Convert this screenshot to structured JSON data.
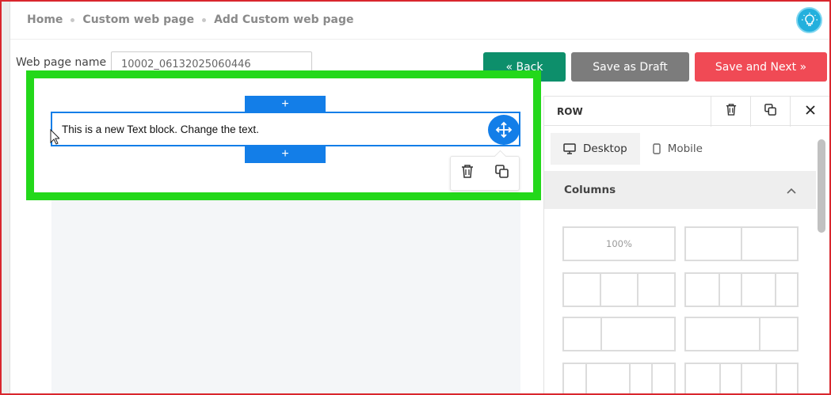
{
  "breadcrumb": {
    "home": "Home",
    "section": "Custom web page",
    "current": "Add Custom web page"
  },
  "form": {
    "name_label": "Web page name :",
    "name_value": "10002_06132025060446"
  },
  "actions": {
    "back": "« Back",
    "draft": "Save as Draft",
    "next": "Save and Next »"
  },
  "editor": {
    "text_block": "This is a new Text block. Change the text.",
    "add_symbol": "+"
  },
  "panel": {
    "title": "ROW",
    "tabs": [
      {
        "label": "Desktop",
        "icon": "monitor-icon"
      },
      {
        "label": "Mobile",
        "icon": "phone-icon"
      }
    ],
    "section_title": "Columns",
    "layouts": [
      {
        "cols": [
          {
            "label": "100%"
          }
        ]
      },
      {
        "cols": [
          {
            "label": ""
          },
          {
            "label": ""
          }
        ]
      },
      {
        "cols": [
          {
            "label": ""
          },
          {
            "label": ""
          },
          {
            "label": ""
          }
        ]
      },
      {
        "cols": [
          {
            "label": ""
          },
          {
            "label": ""
          },
          {
            "label": ""
          },
          {
            "label": ""
          }
        ]
      },
      {
        "cols": [
          {
            "label": ""
          },
          {
            "label": ""
          }
        ]
      },
      {
        "cols": [
          {
            "label": ""
          },
          {
            "label": ""
          }
        ]
      },
      {
        "cols": [
          {
            "label": ""
          },
          {
            "label": ""
          },
          {
            "label": ""
          },
          {
            "label": ""
          }
        ]
      },
      {
        "cols": [
          {
            "label": ""
          },
          {
            "label": ""
          },
          {
            "label": ""
          },
          {
            "label": ""
          }
        ]
      }
    ]
  },
  "colors": {
    "back": "#0d8f6b",
    "draft": "#7c7c7c",
    "next": "#f04a55",
    "accent": "#137ee8",
    "highlight": "#23d81a"
  }
}
